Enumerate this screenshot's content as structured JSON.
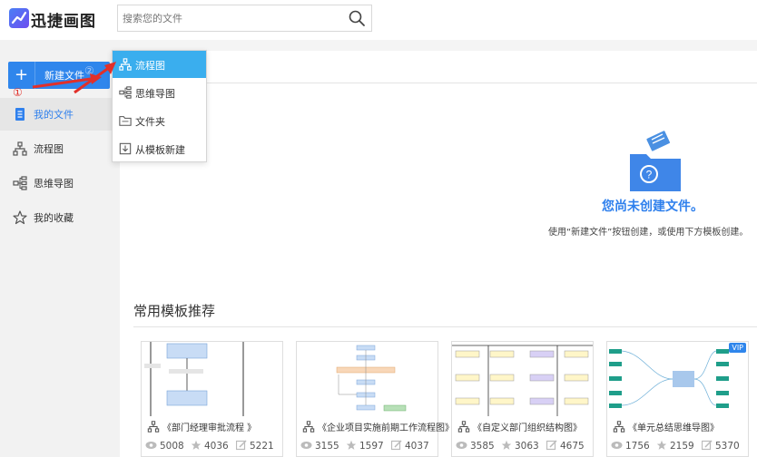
{
  "app": {
    "title": "迅捷画图"
  },
  "search": {
    "placeholder": "搜索您的文件"
  },
  "sidebar": {
    "new_button": {
      "label": "新建文件",
      "marker": "②"
    },
    "marker_1": "①",
    "items": [
      {
        "label": "我的文件",
        "icon": "document-icon",
        "active": true
      },
      {
        "label": "流程图",
        "icon": "flowchart-icon",
        "active": false
      },
      {
        "label": "思维导图",
        "icon": "mindmap-icon",
        "active": false
      },
      {
        "label": "我的收藏",
        "icon": "star-icon",
        "active": false
      }
    ]
  },
  "dropdown": {
    "items": [
      {
        "label": "流程图",
        "icon": "flowchart-icon",
        "active": true
      },
      {
        "label": "思维导图",
        "icon": "mindmap-icon",
        "active": false
      },
      {
        "label": "文件夹",
        "icon": "folder-icon",
        "active": false
      },
      {
        "label": "从模板新建",
        "icon": "template-icon",
        "active": false
      }
    ]
  },
  "empty_state": {
    "title": "您尚未创建文件。",
    "subtitle": "使用“新建文件”按钮创建，或使用下方模板创建。"
  },
  "templates": {
    "section_title": "常用模板推荐",
    "items": [
      {
        "name": "《部门经理审批流程 》",
        "views": "5008",
        "stars": "4036",
        "edits": "5221",
        "vip": false
      },
      {
        "name": "《企业项目实施前期工作流程图》",
        "views": "3155",
        "stars": "1597",
        "edits": "4037",
        "vip": false
      },
      {
        "name": "《自定义部门组织结构图》",
        "views": "3585",
        "stars": "3063",
        "edits": "4675",
        "vip": false
      },
      {
        "name": "《单元总结思维导图》",
        "views": "1756",
        "stars": "2159",
        "edits": "5370",
        "vip": true,
        "vip_label": "VIP"
      }
    ]
  },
  "colors": {
    "accent": "#2f86ec",
    "dropdown_active": "#3aaeee",
    "annotation": "#e2302a"
  }
}
